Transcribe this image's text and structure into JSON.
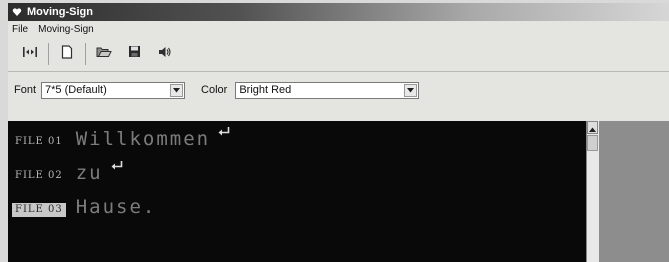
{
  "window": {
    "title": "Moving-Sign"
  },
  "menu": {
    "items": [
      {
        "label": "File"
      },
      {
        "label": "Moving-Sign"
      }
    ]
  },
  "toolbar": {
    "buttons": [
      {
        "icon": "align-icon"
      },
      {
        "icon": "new-document-icon"
      },
      {
        "icon": "open-folder-icon"
      },
      {
        "icon": "save-icon"
      },
      {
        "icon": "speaker-icon"
      }
    ]
  },
  "fontbar": {
    "font_label": "Font",
    "font_value": "7*5 (Default)",
    "color_label": "Color",
    "color_value": "Bright Red"
  },
  "editor": {
    "lines": [
      {
        "label": "FILE 01",
        "text": "Willkommen",
        "selected": false
      },
      {
        "label": "FILE 02",
        "text": "zu",
        "selected": false
      },
      {
        "label": "FILE 03",
        "text": "Hause.",
        "selected": true
      }
    ]
  },
  "colors": {
    "editor_bg": "#090909",
    "label_text": "#b8b8b8",
    "line_text": "#7c7c7c",
    "selected_label_bg": "#c8c8c8"
  }
}
